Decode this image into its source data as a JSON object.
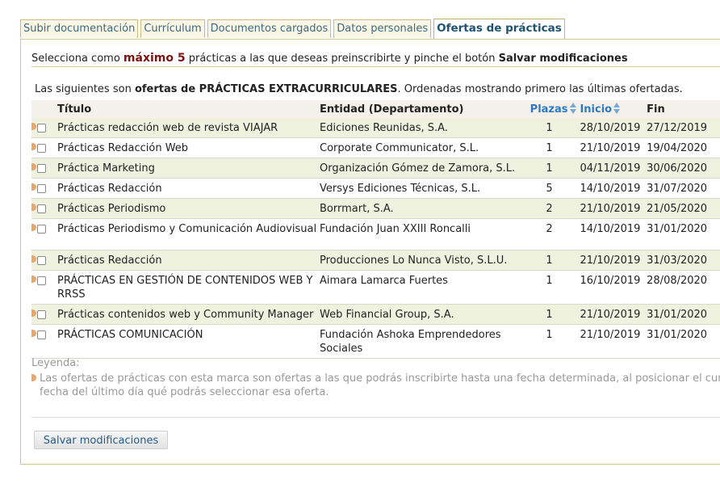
{
  "tabs": [
    {
      "label": "Subir documentación",
      "active": false
    },
    {
      "label": "Currículum",
      "active": false
    },
    {
      "label": "Documentos cargados",
      "active": false
    },
    {
      "label": "Datos personales",
      "active": false
    },
    {
      "label": "Ofertas de prácticas",
      "active": true
    }
  ],
  "intro": {
    "part1": "Selecciona como ",
    "max": "máximo 5",
    "part2": " prácticas a las que deseas preinscribirte y pinche el botón ",
    "button_ref": "Salvar modificaciones"
  },
  "description": {
    "part1": "Las siguientes son ",
    "bold": "ofertas de PRÁCTICAS EXTRACURRICULARES",
    "part2": ". Ordenadas mostrando primero las últimas ofertadas."
  },
  "table": {
    "headers": {
      "title": "Título",
      "entity": "Entidad (Departamento)",
      "places": "Plazas",
      "start": "Inicio",
      "end": "Fin"
    },
    "rows": [
      {
        "title": "Prácticas redacción web de revista VIAJAR",
        "entity": "Ediciones Reunidas, S.A.",
        "places": "1",
        "start": "28/10/2019",
        "end": "27/12/2019"
      },
      {
        "title": "Prácticas Redacción Web",
        "entity": "Corporate Communicator, S.L.",
        "places": "1",
        "start": "21/10/2019",
        "end": "19/04/2020"
      },
      {
        "title": "Práctica Marketing",
        "entity": "Organización Gómez de Zamora, S.L.",
        "places": "1",
        "start": "04/11/2019",
        "end": "30/06/2020"
      },
      {
        "title": "Prácticas Redacción",
        "entity": "Versys Ediciones Técnicas, S.L.",
        "places": "5",
        "start": "14/10/2019",
        "end": "31/07/2020"
      },
      {
        "title": "Prácticas Periodismo",
        "entity": "Borrmart, S.A.",
        "places": "2",
        "start": "21/10/2019",
        "end": "21/05/2020"
      },
      {
        "title": "Prácticas Periodismo y Comunicación Audiovisual",
        "entity": "Fundación Juan XXIII Roncalli",
        "places": "2",
        "start": "14/10/2019",
        "end": "31/01/2020"
      },
      {
        "title": "Prácticas Redacción",
        "entity": "Producciones Lo Nunca Visto, S.L.U.",
        "places": "1",
        "start": "21/10/2019",
        "end": "31/03/2020"
      },
      {
        "title": "PRÁCTICAS EN GESTIÓN DE CONTENIDOS WEB Y RRSS",
        "entity": "Aimara Lamarca Fuertes",
        "places": "1",
        "start": "16/10/2019",
        "end": "28/08/2020"
      },
      {
        "title": "Prácticas contenidos web y Community Manager",
        "entity": "Web Financial Group, S.A.",
        "places": "1",
        "start": "21/10/2019",
        "end": "31/01/2020"
      },
      {
        "title": "PRÁCTICAS COMUNICACIÓN",
        "entity": "Fundación Ashoka Emprendedores Sociales",
        "places": "1",
        "start": "21/10/2019",
        "end": "31/01/2020"
      }
    ]
  },
  "legend": {
    "title": "Leyenda:",
    "line1": "Las ofertas de prácticas con esta marca son ofertas a las que podrás inscribirte hasta una fecha determinada, al posicionar el curso",
    "line2": "fecha del último día qué podrás seleccionar esa oferta."
  },
  "save_button": "Salvar modificaciones",
  "colors": {
    "accent": "#1e5272",
    "highlight": "#7c1212",
    "row_alt": "#eef2df",
    "marker": "#e8a66a",
    "sort_link": "#2f79c4"
  }
}
